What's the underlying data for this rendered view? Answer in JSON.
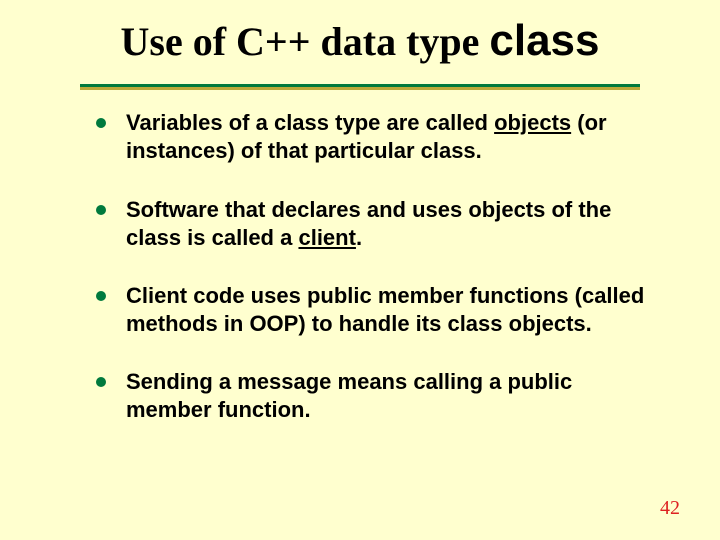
{
  "title": {
    "prefix": "Use of C++ data type ",
    "code_word": "class"
  },
  "bullets": [
    {
      "runs": [
        {
          "t": "Variables of a class type are called "
        },
        {
          "t": "objects",
          "u": true
        },
        {
          "t": " (or instances) of that particular class."
        }
      ]
    },
    {
      "runs": [
        {
          "t": "Software that declares and uses objects of the class is called a "
        },
        {
          "t": "client",
          "u": true
        },
        {
          "t": "."
        }
      ]
    },
    {
      "runs": [
        {
          "t": "Client code uses public member functions (called methods in OOP) to handle its class objects."
        }
      ]
    },
    {
      "runs": [
        {
          "t": "Sending a message means calling a public member function."
        }
      ]
    }
  ],
  "page_number": "42"
}
